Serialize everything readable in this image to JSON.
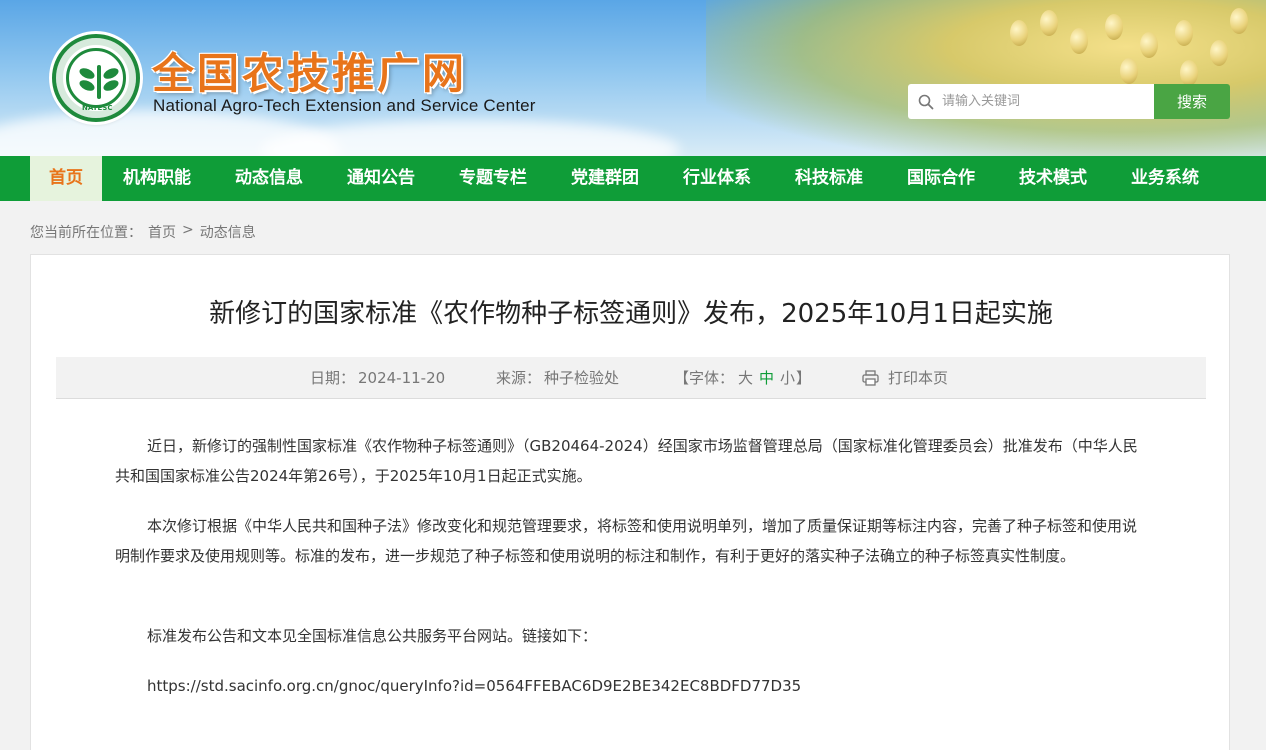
{
  "header": {
    "site_title_cn": "全国农技推广网",
    "site_title_en": "National Agro-Tech Extension and Service Center",
    "logo_text": "NATESC",
    "search_placeholder": "请输入关键词",
    "search_button": "搜索"
  },
  "nav": {
    "items": [
      {
        "label": "首页",
        "active": true
      },
      {
        "label": "机构职能"
      },
      {
        "label": "动态信息"
      },
      {
        "label": "通知公告"
      },
      {
        "label": "专题专栏"
      },
      {
        "label": "党建群团"
      },
      {
        "label": "行业体系"
      },
      {
        "label": "科技标准"
      },
      {
        "label": "国际合作"
      },
      {
        "label": "技术模式"
      },
      {
        "label": "业务系统"
      }
    ]
  },
  "breadcrumb": {
    "prefix": "您当前所在位置：",
    "home": "首页",
    "sep": ">",
    "current": "动态信息"
  },
  "article": {
    "title": "新修订的国家标准《农作物种子标签通则》发布，2025年10月1日起实施",
    "meta": {
      "date_label": "日期：",
      "date": "2024-11-20",
      "source_label": "来源：",
      "source": "种子检验处",
      "font_open": "【字体：",
      "font_large": "大",
      "font_medium": "中",
      "font_small": "小",
      "font_close": "】",
      "print": "打印本页"
    },
    "paragraphs": [
      "近日，新修订的强制性国家标准《农作物种子标签通则》（GB20464-2024）经国家市场监督管理总局（国家标准化管理委员会）批准发布（中华人民共和国国家标准公告2024年第26号），于2025年10月1日起正式实施。",
      "本次修订根据《中华人民共和国种子法》修改变化和规范管理要求，将标签和使用说明单列，增加了质量保证期等标注内容，完善了种子标签和使用说明制作要求及使用规则等。标准的发布，进一步规范了种子标签和使用说明的标注和制作，有利于更好的落实种子法确立的种子标签真实性制度。",
      "标准发布公告和文本见全国标准信息公共服务平台网站。链接如下：",
      "https://std.sacinfo.org.cn/gnoc/queryInfo?id=0564FFEBAC6D9E2BE342EC8BDFD77D35"
    ]
  },
  "colors": {
    "nav_green": "#0f9d38",
    "title_orange": "#e8741a",
    "search_green": "#4aa544"
  }
}
